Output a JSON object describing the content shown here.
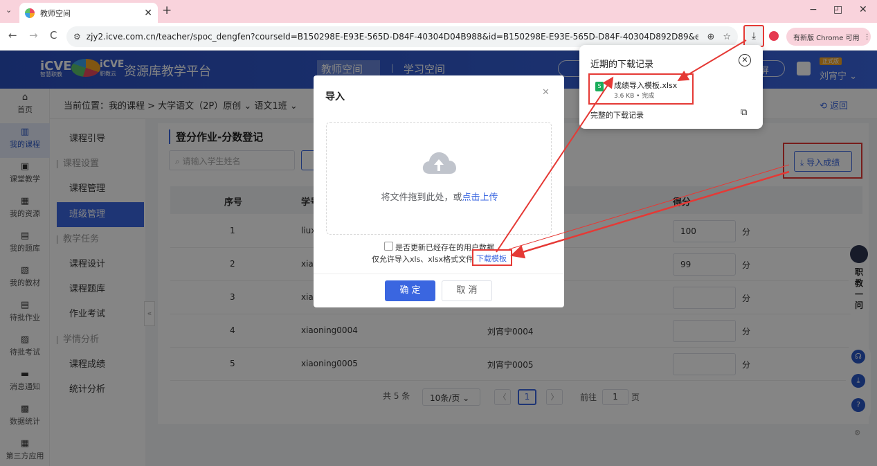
{
  "browser": {
    "tab_title": "教师空间",
    "tab_menu_icon": "⌄",
    "tab_close": "✕",
    "new_tab": "+",
    "url": "zjy2.icve.com.cn/teacher/spoc_dengfen?courseId=B150298E-E93E-565D-D84F-40304D04B988&id=B150298E-E93E-565D-D84F-40304D892D89&examId=B1...",
    "update_label": "有新版 Chrome 可用",
    "back": "←",
    "forward": "→",
    "reload": "C",
    "window_min": "−",
    "window_max": "◰",
    "window_close": "✕"
  },
  "site": {
    "logo1": "iCVE",
    "logo1_sub": "智慧职教",
    "logo2": "iCVE",
    "logo2_sub": "职教云",
    "platform": "资源库教学平台",
    "nav_teacher": "教师空间",
    "nav_sep": "|",
    "nav_student": "学习空间",
    "nav_screen": "屏",
    "trial_badge": "正式版",
    "user_name": "刘宵宁 ⌄"
  },
  "rail": [
    {
      "icon": "⌂",
      "label": "首页"
    },
    {
      "icon": "▥",
      "label": "我的课程"
    },
    {
      "icon": "▣",
      "label": "课堂教学"
    },
    {
      "icon": "▦",
      "label": "我的资源"
    },
    {
      "icon": "▤",
      "label": "我的题库"
    },
    {
      "icon": "▧",
      "label": "我的教材"
    },
    {
      "icon": "▤",
      "label": "待批作业"
    },
    {
      "icon": "▨",
      "label": "待批考试"
    },
    {
      "icon": "▬",
      "label": "消息通知"
    },
    {
      "icon": "▩",
      "label": "数据统计"
    },
    {
      "icon": "▦",
      "label": "第三方应用"
    }
  ],
  "breadcrumb": {
    "text": "当前位置：我的课程 > 大学语文（2P）原创 ⌄  语文1班 ⌄",
    "back": "⟲ 返回"
  },
  "submenu": [
    {
      "label": "课程引导",
      "type": "item"
    },
    {
      "label": "课程设置",
      "type": "group"
    },
    {
      "label": "课程管理",
      "type": "item"
    },
    {
      "label": "班级管理",
      "type": "active"
    },
    {
      "label": "教学任务",
      "type": "group"
    },
    {
      "label": "课程设计",
      "type": "item"
    },
    {
      "label": "课程题库",
      "type": "item"
    },
    {
      "label": "作业考试",
      "type": "item"
    },
    {
      "label": "学情分析",
      "type": "group"
    },
    {
      "label": "课程成绩",
      "type": "item"
    },
    {
      "label": "统计分析",
      "type": "item"
    }
  ],
  "main": {
    "title": "登分作业-分数登记",
    "search_placeholder": "请输入学生姓名",
    "import_button": "⤓ 导入成绩",
    "columns": [
      "序号",
      "学号",
      "得分"
    ],
    "rows": [
      {
        "no": "1",
        "sid": "liux",
        "name": "",
        "score": "100"
      },
      {
        "no": "2",
        "sid": "xia",
        "name": "",
        "score": "99"
      },
      {
        "no": "3",
        "sid": "xia",
        "name": "",
        "score": ""
      },
      {
        "no": "4",
        "sid": "xiaoning0004",
        "name": "刘宵宁0004",
        "score": ""
      },
      {
        "no": "5",
        "sid": "xiaoning0005",
        "name": "刘宵宁0005",
        "score": ""
      }
    ],
    "unit": "分",
    "pager": {
      "total": "共 5 条",
      "page_size": "10条/页  ⌄",
      "prev": "〈",
      "current": "1",
      "next": "〉",
      "goto": "前往",
      "goto_value": "1",
      "page_suffix": "页"
    }
  },
  "modal": {
    "title": "导入",
    "close": "✕",
    "drop_text": "将文件拖到此处，或",
    "upload_link": "点击上传",
    "update_checkbox": "是否更新已经存在的用户数据",
    "tip": "仅允许导入xls、xlsx格式文件。",
    "download_template": "下载模板",
    "ok": "确 定",
    "cancel": "取 消"
  },
  "download_popup": {
    "title": "近期的下载记录",
    "close": "✕",
    "file_icon": "S",
    "file_name": "成绩导入模板.xlsx",
    "file_meta": "3.6 KB • 完成",
    "full_history": "完整的下载记录",
    "open_icon": "⧉"
  },
  "widget": {
    "robot_text": "职教一问",
    "side_close": "⊗"
  },
  "colors": {
    "primary": "#3a66e0",
    "header": "#2a4fbf",
    "highlight": "#e53935",
    "tabbar": "#f9d3dc"
  }
}
